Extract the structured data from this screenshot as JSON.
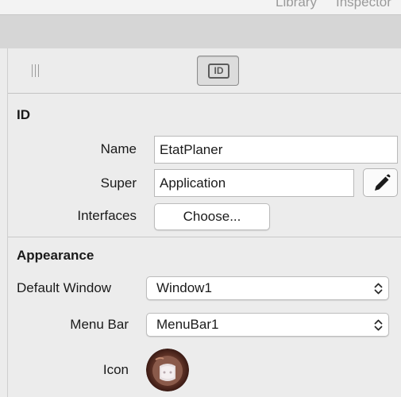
{
  "toolbar": {
    "library_label": "Library",
    "inspector_label": "Inspector"
  },
  "inspector": {
    "tabs": {
      "handle_icon": "grip-handle-icon",
      "id_tab_icon": "id-card-icon",
      "id_tab_text": "ID"
    },
    "id_section": {
      "title": "ID",
      "name_label": "Name",
      "name_value": "EtatPlaner",
      "super_label": "Super",
      "super_value": "Application",
      "pencil_icon": "pencil-icon",
      "interfaces_label": "Interfaces",
      "choose_button": "Choose..."
    },
    "appearance_section": {
      "title": "Appearance",
      "default_window_label": "Default Window",
      "default_window_value": "Window1",
      "menu_bar_label": "Menu Bar",
      "menu_bar_value": "MenuBar1",
      "icon_label": "Icon",
      "icon_image": "app-icon-thumbnail"
    }
  },
  "colors": {
    "panel_bg": "#ececec",
    "toolbar_band": "#d6d6d6",
    "field_bg": "#ffffff",
    "border": "#b9b9b9",
    "text": "#1a1a1a",
    "muted_text": "#9a9a9a"
  }
}
